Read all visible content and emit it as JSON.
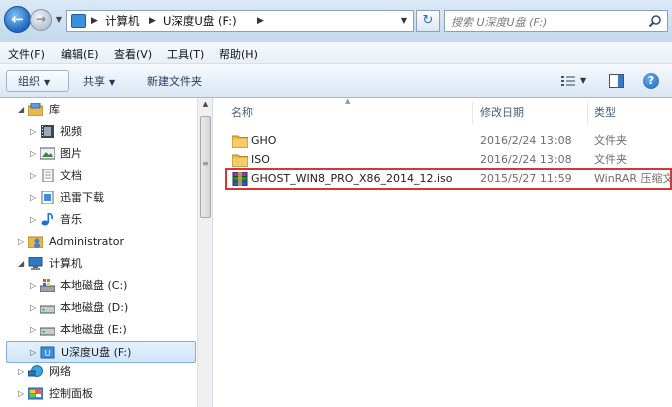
{
  "address": {
    "crumbs": [
      "计算机",
      "U深度U盘 (F:)"
    ],
    "search_placeholder": "搜索 U深度U盘 (F:)"
  },
  "menu": [
    "文件(F)",
    "编辑(E)",
    "查看(V)",
    "工具(T)",
    "帮助(H)"
  ],
  "toolbar": {
    "organize": "组织",
    "share": "共享",
    "new_folder": "新建文件夹"
  },
  "nav": {
    "items": [
      {
        "label": "库",
        "icon": "library-icon"
      },
      {
        "label": "视频",
        "icon": "video-icon"
      },
      {
        "label": "图片",
        "icon": "pictures-icon"
      },
      {
        "label": "文档",
        "icon": "documents-icon"
      },
      {
        "label": "迅雷下载",
        "icon": "downloads-icon"
      },
      {
        "label": "音乐",
        "icon": "music-icon"
      },
      {
        "label": "Administrator",
        "icon": "user-folder-icon"
      },
      {
        "label": "计算机",
        "icon": "computer-icon"
      },
      {
        "label": "本地磁盘 (C:)",
        "icon": "system-drive-icon"
      },
      {
        "label": "本地磁盘 (D:)",
        "icon": "drive-icon"
      },
      {
        "label": "本地磁盘 (E:)",
        "icon": "drive-icon"
      },
      {
        "label": "U深度U盘 (F:)",
        "icon": "usb-drive-icon"
      },
      {
        "label": "网络",
        "icon": "network-icon"
      },
      {
        "label": "控制面板",
        "icon": "control-panel-icon"
      }
    ]
  },
  "columns": {
    "name": "名称",
    "date": "修改日期",
    "type": "类型"
  },
  "files": [
    {
      "name": "GHO",
      "date": "2016/2/24 13:08",
      "type": "文件夹",
      "icon": "folder-icon"
    },
    {
      "name": "ISO",
      "date": "2016/2/24 13:08",
      "type": "文件夹",
      "icon": "folder-icon"
    },
    {
      "name": "GHOST_WIN8_PRO_X86_2014_12.iso",
      "date": "2015/5/27 11:59",
      "type": "WinRAR 压缩文",
      "icon": "winrar-archive-icon"
    }
  ],
  "colors": {
    "highlight_box": "#d23838",
    "selected_bg": "#cfe5fa",
    "folder": "#e8b84a"
  }
}
